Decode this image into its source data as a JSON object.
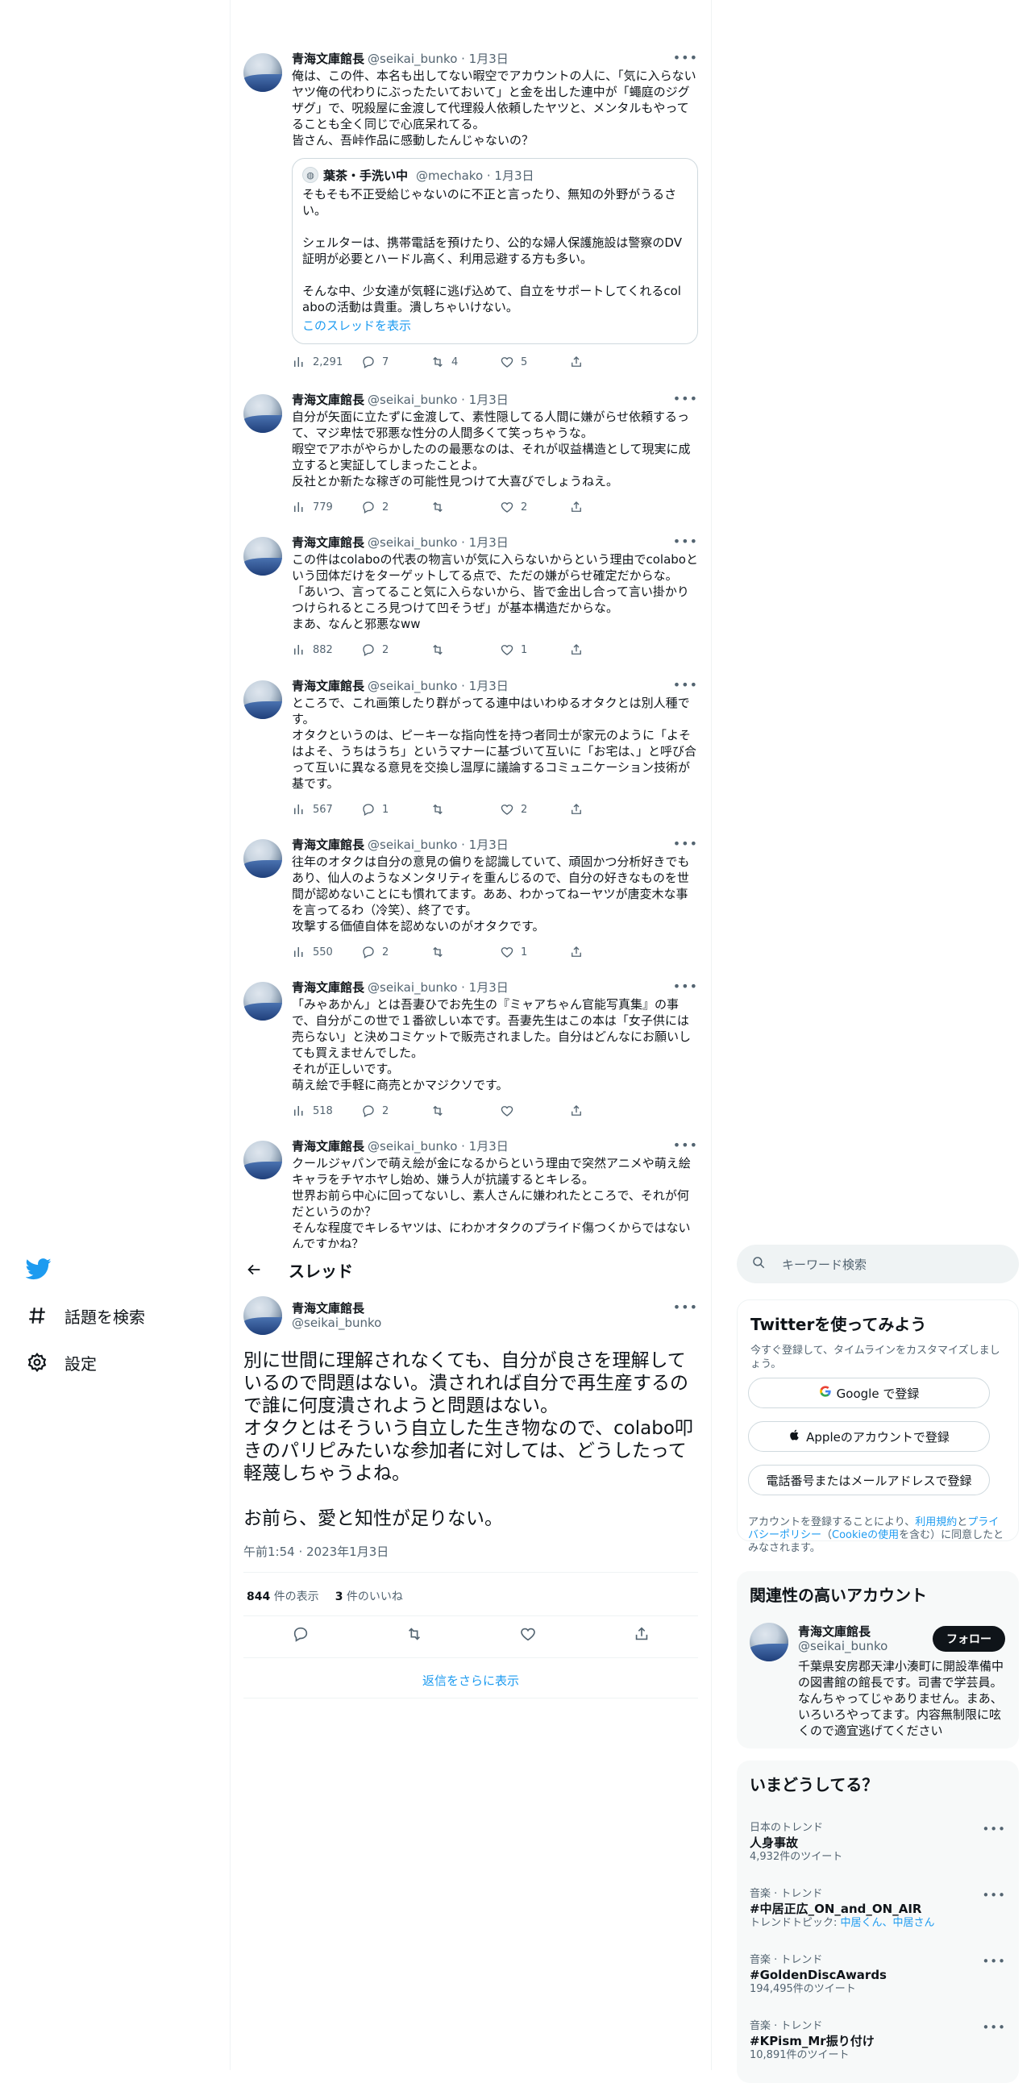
{
  "nav": {
    "items": [
      {
        "label": "話題を検索",
        "icon": "hashtag-icon"
      },
      {
        "label": "設定",
        "icon": "gear-icon"
      }
    ]
  },
  "thread": {
    "title": "スレッド",
    "tweets": [
      {
        "name": "青海文庫館長",
        "meta": "@seikai_bunko · 1月3日",
        "text": "俺は、この件、本名も出してない暇空でアカウントの人に、「気に入らないヤツ俺の代わりにぶったたいておいて」と金を出した連中が「蠅庭のジグザグ」で、呪殺屋に金渡して代理殺人依頼したヤツと、メンタルもやってることも全く同じで心底呆れてる。\n皆さん、吾峠作品に感動したんじゃないの？",
        "quote": {
          "name": "葉茶・手洗い中",
          "meta": "@mechako · 1月3日",
          "text": "そもそも不正受給じゃないのに不正と言ったり、無知の外野がうるさい。\n\nシェルターは、携帯電話を預けたり、公的な婦人保護施設は警察のDV証明が必要とハードル高く、利用忌避する方も多い。\n\nそんな中、少女達が気軽に逃げ込めて、自立をサポートしてくれるcolaboの活動は貴重。潰しちゃいけない。",
          "link": "このスレッドを表示"
        },
        "views": "2,291",
        "replies": "7",
        "retweets": "4",
        "likes": "5"
      },
      {
        "name": "青海文庫館長",
        "meta": "@seikai_bunko · 1月3日",
        "text": "自分が矢面に立たずに金渡して、素性隠してる人間に嫌がらせ依頼するって、マジ卑怯で邪悪な性分の人間多くて笑っちゃうな。\n暇空でアホがやらかしたのの最悪なのは、それが収益構造として現実に成立すると実証してしまったことよ。\n反社とか新たな稼ぎの可能性見つけて大喜びでしょうねえ。",
        "views": "779",
        "replies": "2",
        "retweets": "",
        "likes": "2"
      },
      {
        "name": "青海文庫館長",
        "meta": "@seikai_bunko · 1月3日",
        "text": "この件はcolaboの代表の物言いが気に入らないからという理由でcolaboという団体だけをターゲットしてる点で、ただの嫌がらせ確定だからな。\n「あいつ、言ってること気に入らないから、皆で金出し合って言い掛かりつけられるところ見つけて凹そうぜ」が基本構造だからな。\nまあ、なんと邪悪なww",
        "views": "882",
        "replies": "2",
        "retweets": "",
        "likes": "1"
      },
      {
        "name": "青海文庫館長",
        "meta": "@seikai_bunko · 1月3日",
        "text": "ところで、これ画策したり群がってる連中はいわゆるオタクとは別人種です。\nオタクというのは、ピーキーな指向性を持つ者同士が家元のように「よそはよそ、うちはうち」というマナーに基づいて互いに「お宅は、」と呼び合って互いに異なる意見を交換し温厚に議論するコミュニケーション技術が基です。",
        "views": "567",
        "replies": "1",
        "retweets": "",
        "likes": "2"
      },
      {
        "name": "青海文庫館長",
        "meta": "@seikai_bunko · 1月3日",
        "text": "往年のオタクは自分の意見の偏りを認識していて、頑固かつ分析好きでもあり、仙人のようなメンタリティを重んじるので、自分の好きなものを世間が認めないことにも慣れてます。ああ、わかってねーヤツが唐変木な事を言ってるわ（冷笑）、終了です。\n攻撃する価値自体を認めないのがオタクです。",
        "views": "550",
        "replies": "2",
        "retweets": "",
        "likes": "1"
      },
      {
        "name": "青海文庫館長",
        "meta": "@seikai_bunko · 1月3日",
        "text": "「みゃあかん」とは吾妻ひでお先生の『ミャアちゃん官能写真集』の事で、自分がこの世で１番欲しい本です。吾妻先生はこの本は「女子供には売らない」と決めコミケットで販売されました。自分はどんなにお願いしても買えませんでした。\nそれが正しいです。\n萌え絵で手軽に商売とかマジクソです。",
        "views": "518",
        "replies": "2",
        "retweets": "",
        "likes": ""
      },
      {
        "name": "青海文庫館長",
        "meta": "@seikai_bunko · 1月3日",
        "text": "クールジャパンで萌え絵が金になるからという理由で突然アニメや萌え絵キャラをチヤホヤし始め、嫌う人が抗議するとキレる。\n世界お前ら中心に回ってないし、素人さんに嫌われたところで、それが何だというのか？\nそんな程度でキレるヤツは、にわかオタクのプライド傷つくからではないんですかね？"
      }
    ],
    "main": {
      "name": "青海文庫館長",
      "handle": "@seikai_bunko",
      "text": "別に世間に理解されなくても、自分が良さを理解しているので問題はない。潰されれば自分で再生産するので誰に何度潰されようと問題はない。\nオタクとはそういう自立した生き物なので、colabo叩きのパリピみたいな参加者に対しては、どうしたって軽蔑しちゃうよね。\n\nお前ら、愛と知性が足りない。",
      "time": "午前1:54 · 2023年1月3日",
      "views_count": "844",
      "views_label": "件の表示",
      "likes_count": "3",
      "likes_label": "件のいいね"
    },
    "more_replies": "返信をさらに表示"
  },
  "sidebar": {
    "search_placeholder": "キーワード検索",
    "signup": {
      "title": "Twitterを使ってみよう",
      "subtitle": "今すぐ登録して、タイムラインをカスタマイズしましょう。",
      "google": "Google で登録",
      "apple": "Appleのアカウントで登録",
      "phone": "電話番号またはメールアドレスで登録",
      "terms_1": "アカウントを登録することにより、",
      "terms_link1": "利用規約",
      "terms_2": "と",
      "terms_link2": "プライバシーポリシー",
      "terms_3": "（",
      "terms_link3": "Cookieの使用",
      "terms_4": "を含む）に同意したとみなされます。"
    },
    "related": {
      "title": "関連性の高いアカウント",
      "name": "青海文庫館長",
      "handle": "@seikai_bunko",
      "follow": "フォロー",
      "bio": "千葉県安房郡天津小湊町に開設準備中の図書館の館長です。司書で学芸員。なんちゃってじゃありません。まあ、いろいろやってます。内容無制限に呟くので適宜逃げてください"
    },
    "trends": {
      "title": "いまどうしてる？",
      "items": [
        {
          "category": "日本のトレンド",
          "name": "人身事故",
          "sub": "4,932件のツイート"
        },
        {
          "category": "音楽 · トレンド",
          "name": "#中居正広_ON_and_ON_AIR",
          "sub_prefix": "トレンドトピック: ",
          "sub_link": "中居くん、中居さん"
        },
        {
          "category": "音楽 · トレンド",
          "name": "#GoldenDiscAwards",
          "sub": "194,495件のツイート"
        },
        {
          "category": "音楽 · トレンド",
          "name": "#KPism_Mr振り付け",
          "sub": "10,891件のツイート"
        }
      ]
    }
  }
}
